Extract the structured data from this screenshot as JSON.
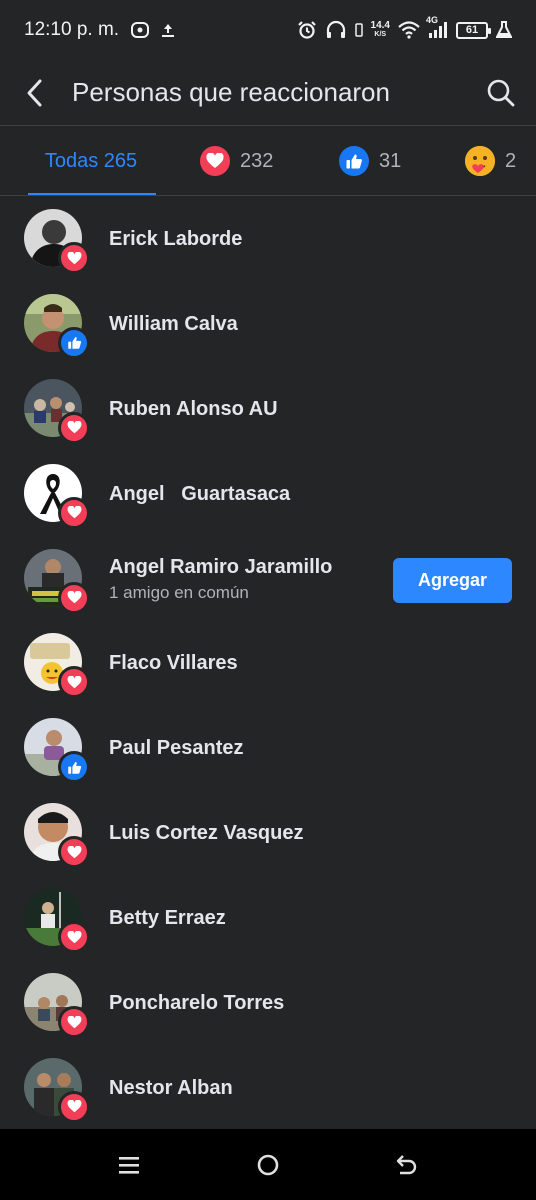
{
  "status_bar": {
    "time": "12:10 p. m.",
    "net_speed": "14.4",
    "net_unit": "K/S",
    "network": "4G",
    "battery": "61"
  },
  "header": {
    "title": "Personas que reaccionaron",
    "back_icon": "chevron-left-icon",
    "search_icon": "search-icon"
  },
  "tabs": {
    "all": "Todas 265",
    "love_count": "232",
    "like_count": "31",
    "care_count": "2"
  },
  "people": [
    {
      "name": "Erick Laborde",
      "reaction": "love",
      "subtitle": ""
    },
    {
      "name": "William Calva",
      "reaction": "like",
      "subtitle": ""
    },
    {
      "name": "Ruben Alonso AU",
      "reaction": "love",
      "subtitle": ""
    },
    {
      "name": "Angel   Guartasaca",
      "reaction": "love",
      "subtitle": ""
    },
    {
      "name": "Angel Ramiro Jaramillo",
      "reaction": "love",
      "subtitle": "1 amigo en común",
      "action": "Agregar"
    },
    {
      "name": "Flaco Villares",
      "reaction": "love",
      "subtitle": ""
    },
    {
      "name": "Paul Pesantez",
      "reaction": "like",
      "subtitle": ""
    },
    {
      "name": "Luis Cortez Vasquez",
      "reaction": "love",
      "subtitle": ""
    },
    {
      "name": "Betty Erraez",
      "reaction": "love",
      "subtitle": ""
    },
    {
      "name": "Poncharelo Torres",
      "reaction": "love",
      "subtitle": ""
    },
    {
      "name": "Nestor Alban",
      "reaction": "love",
      "subtitle": ""
    }
  ],
  "colors": {
    "background": "#242526",
    "accent": "#2d88ff",
    "love": "#f33e58",
    "like": "#1877f2",
    "care": "#f7b125"
  }
}
